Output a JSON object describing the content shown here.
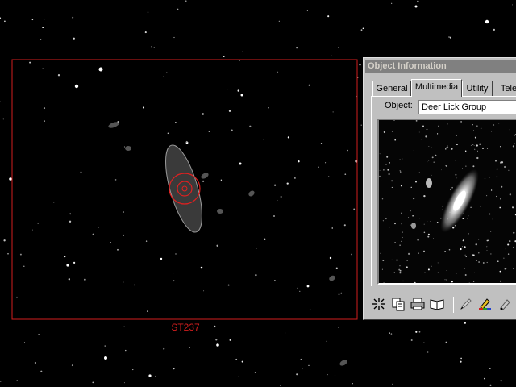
{
  "sky": {
    "fov_label": "ST237"
  },
  "object_info": {
    "title": "Object Information",
    "tabs": [
      {
        "label": "General"
      },
      {
        "label": "Multimedia"
      },
      {
        "label": "Utility"
      },
      {
        "label": "Tele"
      }
    ],
    "active_tab": "Multimedia",
    "object_label": "Object:",
    "object_value": "Deer Lick Group"
  },
  "toolbar": {
    "icons": [
      "crosshair-icon",
      "copy-icon",
      "print-icon",
      "book-icon",
      "pencil-icon",
      "edit-color-icon",
      "scroll-icon"
    ]
  },
  "colors": {
    "fov_frame": "#d21e1e",
    "window_face": "#c0c0c0",
    "titlebar": "#808080"
  }
}
